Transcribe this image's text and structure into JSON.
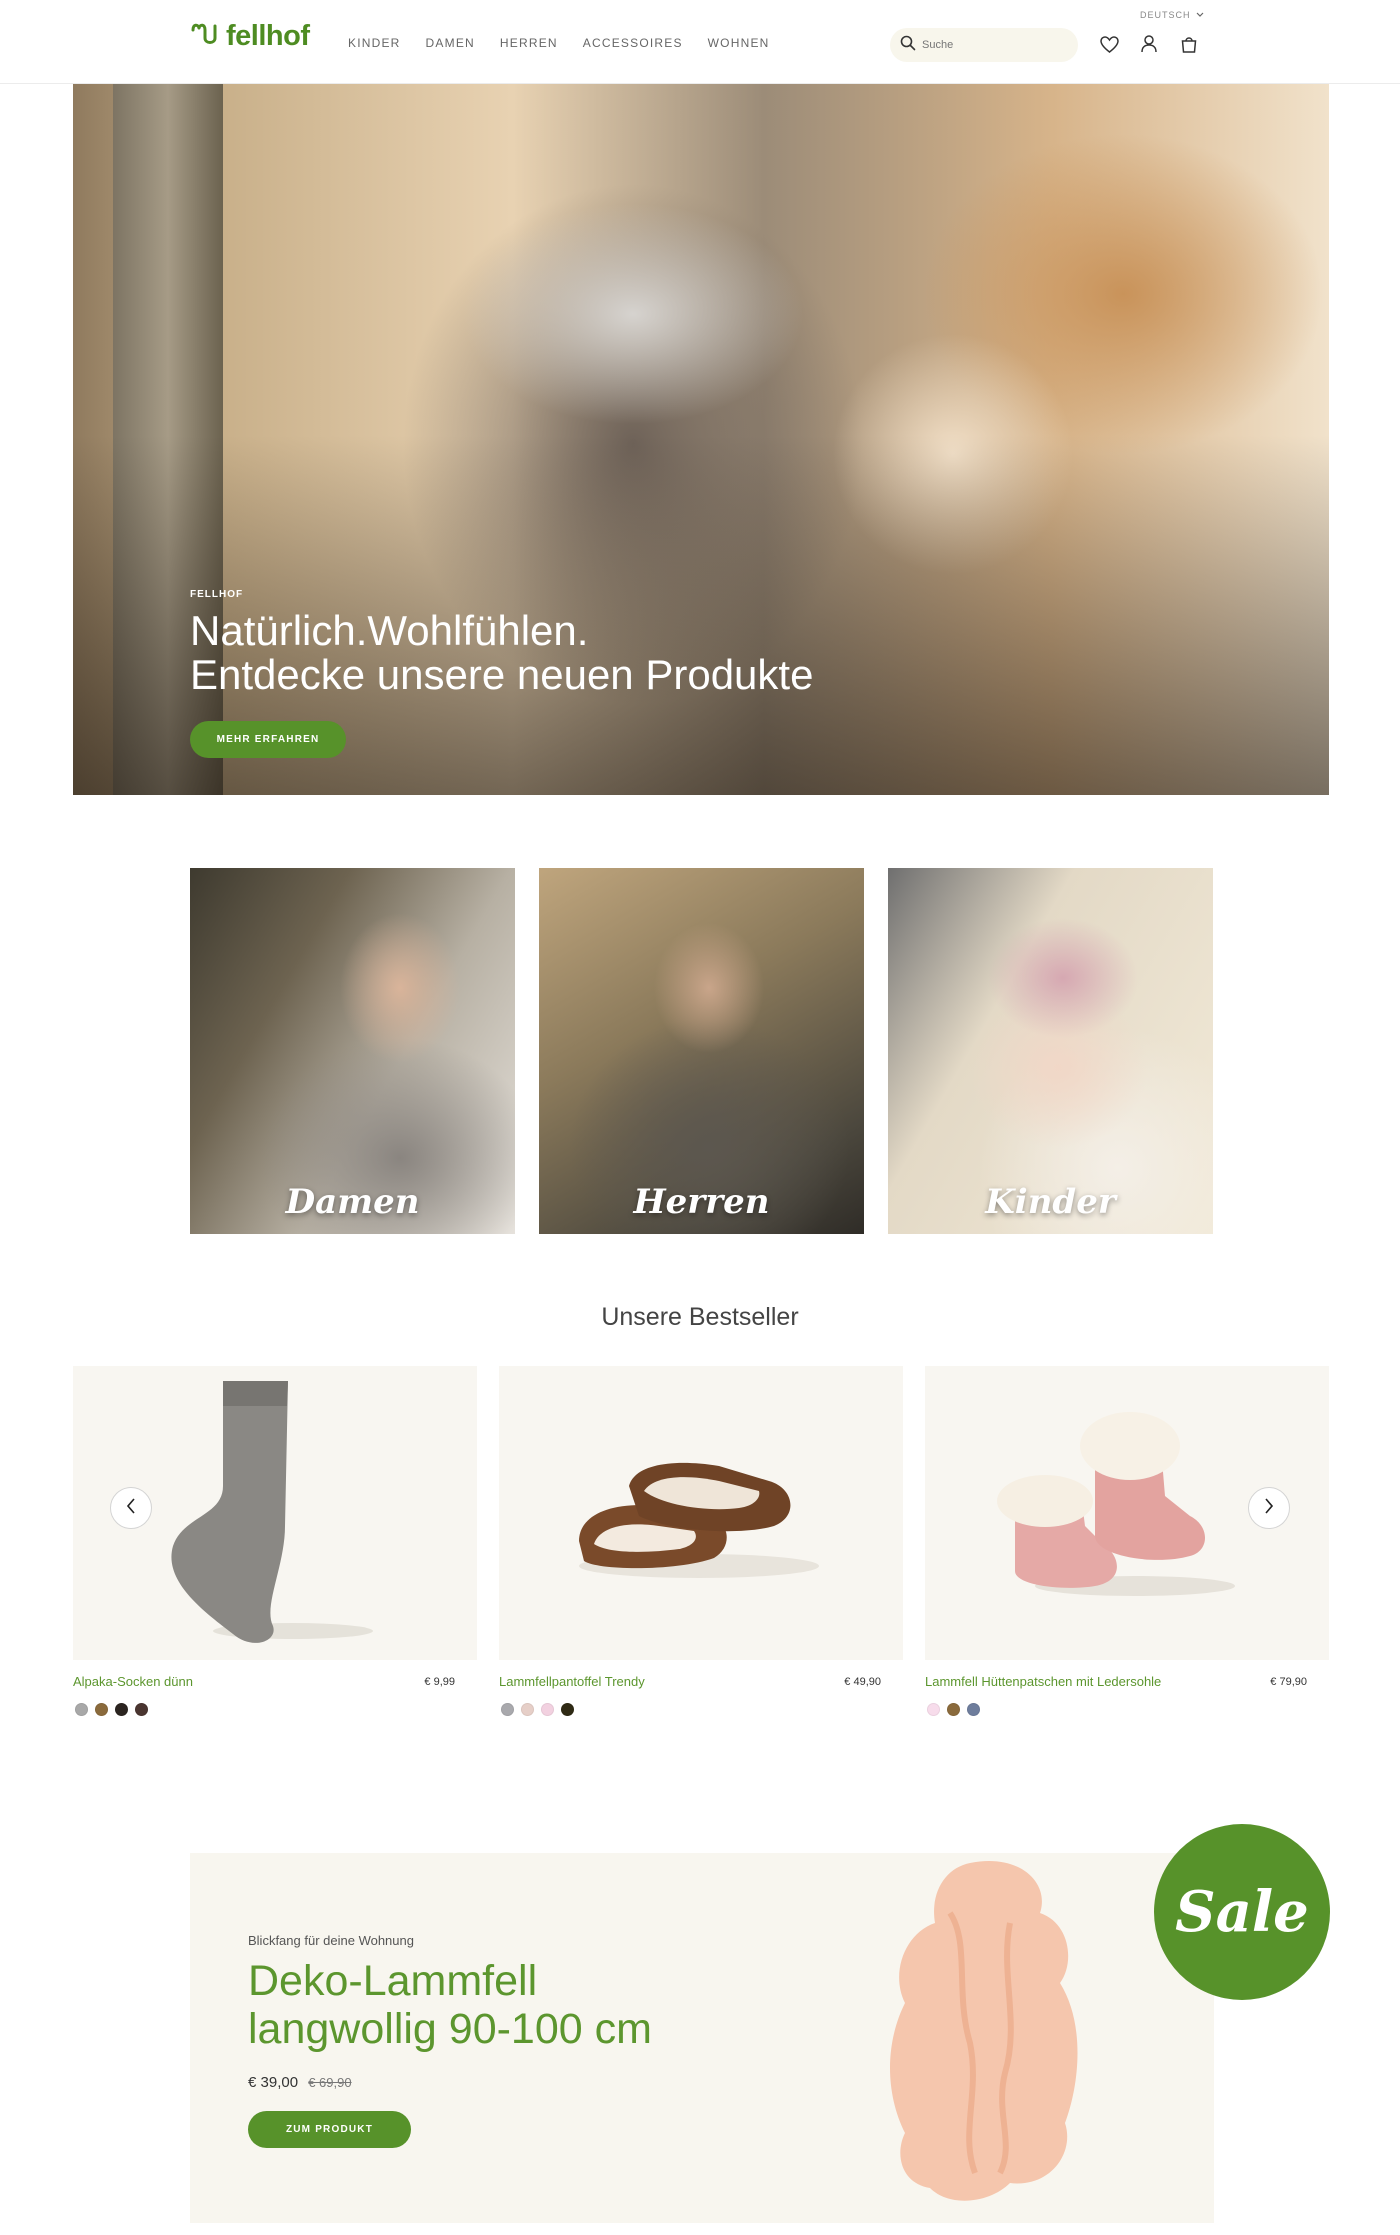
{
  "header": {
    "logo_text": "fellhof",
    "nav": [
      "KINDER",
      "DAMEN",
      "HERREN",
      "ACCESSOIRES",
      "WOHNEN"
    ],
    "language": "DEUTSCH",
    "search_placeholder": "Suche"
  },
  "hero": {
    "kicker": "FELLHOF",
    "title_line1": "Natürlich.Wohlfühlen.",
    "title_line2": "Entdecke unsere neuen Produkte",
    "button": "MEHR ERFAHREN"
  },
  "categories": [
    "Damen",
    "Herren",
    "Kinder"
  ],
  "bestseller": {
    "title": "Unsere Bestseller",
    "products": [
      {
        "name": "Alpaka-Socken dünn",
        "price": "€ 9,99",
        "swatches": [
          "#a8a8a8",
          "#8a6a3c",
          "#2b2420",
          "#4a3530"
        ]
      },
      {
        "name": "Lammfellpantoffel Trendy",
        "price": "€ 49,90",
        "swatches": [
          "#a9a9ad",
          "#e6cfc8",
          "#f2d1e0",
          "#2f2a14"
        ]
      },
      {
        "name": "Lammfell Hüttenpatschen mit Ledersohle",
        "price": "€ 79,90",
        "swatches": [
          "#f7dceb",
          "#8a6a3c",
          "#6e7d9c"
        ]
      }
    ]
  },
  "promo": {
    "kicker": "Blickfang für deine Wohnung",
    "title_line1": "Deko-Lammfell",
    "title_line2": "langwollig 90-100 cm",
    "price": "€ 39,00",
    "old_price": "€ 69,90",
    "button": "ZUM PRODUKT",
    "badge": "Sale"
  },
  "colors": {
    "brand_green": "#57922a",
    "product_green": "#5c962e"
  }
}
